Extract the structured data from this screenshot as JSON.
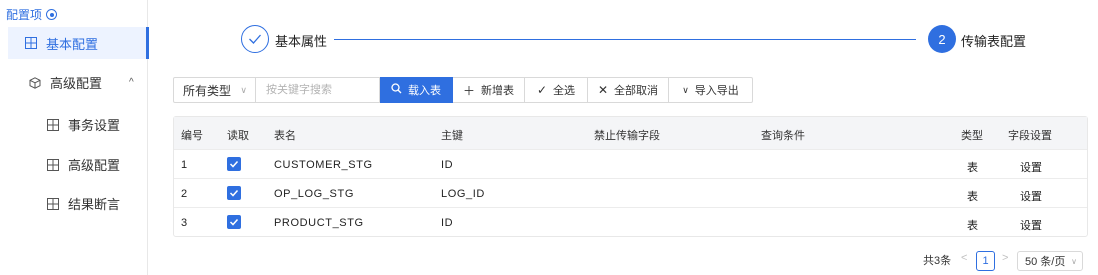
{
  "sidebar": {
    "title": "配置项",
    "items": [
      {
        "label": "基本配置"
      },
      {
        "label": "高级配置",
        "chevron": "^"
      },
      {
        "label": "事务设置"
      },
      {
        "label": "高级配置"
      },
      {
        "label": "结果断言"
      }
    ]
  },
  "steps": [
    {
      "label": "基本属性",
      "icon": "check-icon"
    },
    {
      "number": "2",
      "label": "传输表配置"
    }
  ],
  "toolbar": {
    "type_select": "所有类型",
    "search_placeholder": "按关键字搜索",
    "load_label": "载入表",
    "add_label": "新增表",
    "select_all_label": "全选",
    "deselect_all_label": "全部取消",
    "import_export_label": "导入导出"
  },
  "table": {
    "columns": [
      "编号",
      "读取",
      "表名",
      "主键",
      "禁止传输字段",
      "查询条件",
      "类型",
      "字段设置"
    ],
    "rows": [
      {
        "no": "1",
        "name": "CUSTOMER_STG",
        "pk": "ID",
        "type": "表",
        "action": "设置",
        "checked": true
      },
      {
        "no": "2",
        "name": "OP_LOG_STG",
        "pk": "LOG_ID",
        "type": "表",
        "action": "设置",
        "checked": true
      },
      {
        "no": "3",
        "name": "PRODUCT_STG",
        "pk": "ID",
        "type": "表",
        "action": "设置",
        "checked": true
      }
    ]
  },
  "pagination": {
    "total": "共3条",
    "current": "1",
    "page_size": "50 条/页"
  },
  "colors": {
    "accent": "#2f6fe0"
  }
}
